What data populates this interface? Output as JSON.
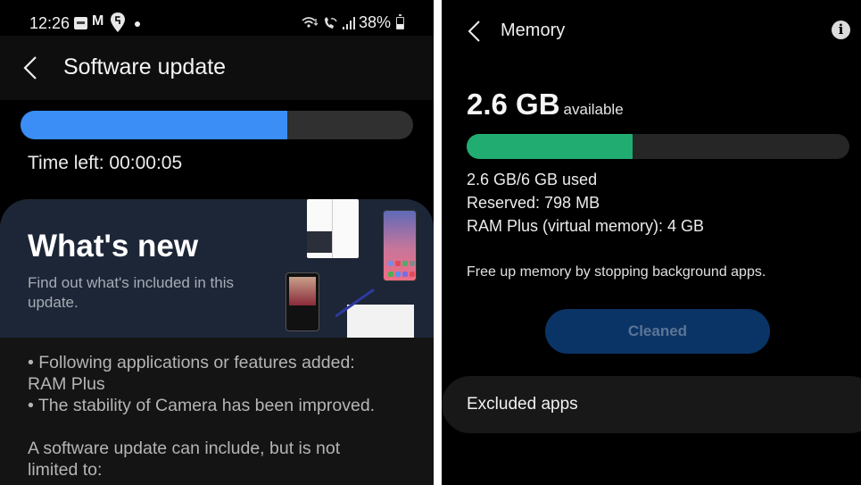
{
  "left_screen": {
    "status_bar": {
      "time": "12:26",
      "notification_icons": [
        "paytm-icon",
        "gmail-icon",
        "swiggy-icon",
        "more-dot-icon"
      ],
      "system_icons": [
        "wifi-calling-icon",
        "volte-call-icon",
        "signal-icon"
      ],
      "battery_percent_text": "38%",
      "battery_level": 0.38
    },
    "header": {
      "title": "Software update",
      "back_icon": "chevron-left-icon"
    },
    "progress": {
      "value": 0.68,
      "color": "#3a8ef6",
      "time_left_label": "Time left: 00:00:05"
    },
    "whats_new": {
      "title": "What's new",
      "subtitle": "Find out what's included in this update."
    },
    "notes": {
      "lines": [
        "• Following applications or features added:",
        "RAM Plus",
        "• The stability of Camera has been improved.",
        "",
        "A software update can include, but is not",
        "limited to:"
      ]
    }
  },
  "right_screen": {
    "header": {
      "title": "Memory",
      "back_icon": "chevron-left-icon",
      "info_icon": "info-icon",
      "info_glyph": "i"
    },
    "available": {
      "value": "2.6 GB",
      "suffix": "available"
    },
    "usage_bar": {
      "value": 0.433,
      "color": "#21ad72"
    },
    "details": [
      "2.6 GB/6 GB used",
      "Reserved: 798 MB",
      "RAM Plus (virtual memory): 4 GB"
    ],
    "hint": "Free up memory by stopping background apps.",
    "cleaned_button": "Cleaned",
    "excluded_apps_label": "Excluded apps"
  }
}
